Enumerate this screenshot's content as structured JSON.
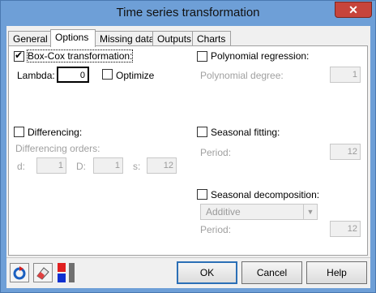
{
  "window": {
    "title": "Time series transformation",
    "close_glyph": "✕"
  },
  "tabs": [
    {
      "label": "General"
    },
    {
      "label": "Options"
    },
    {
      "label": "Missing data"
    },
    {
      "label": "Outputs"
    },
    {
      "label": "Charts"
    }
  ],
  "active_tab": "Options",
  "left": {
    "boxcox": {
      "label": "Box-Cox transformation:",
      "checked": true
    },
    "lambda": {
      "label": "Lambda:",
      "value": "0"
    },
    "optimize": {
      "label": "Optimize",
      "checked": false
    },
    "differencing": {
      "label": "Differencing:",
      "checked": false
    },
    "diff_orders": {
      "label": "Differencing orders:"
    },
    "d": {
      "label": "d:",
      "value": "1"
    },
    "D": {
      "label": "D:",
      "value": "1"
    },
    "s": {
      "label": "s:",
      "value": "12"
    }
  },
  "right": {
    "poly": {
      "label": "Polynomial regression:",
      "checked": false
    },
    "poly_degree": {
      "label": "Polynomial degree:",
      "value": "1"
    },
    "seasonal_fit": {
      "label": "Seasonal fitting:",
      "checked": false
    },
    "seasonal_fit_period": {
      "label": "Period:",
      "value": "12"
    },
    "seasonal_decomp": {
      "label": "Seasonal decomposition:",
      "checked": false
    },
    "decomp_type": {
      "value": "Additive"
    },
    "decomp_period": {
      "label": "Period:",
      "value": "12"
    }
  },
  "buttons": {
    "ok": "OK",
    "cancel": "Cancel",
    "help": "Help"
  },
  "colors": {
    "titlebar": "#6e9fd7",
    "close": "#c7443b",
    "default_button_border": "#2b6fb6"
  }
}
